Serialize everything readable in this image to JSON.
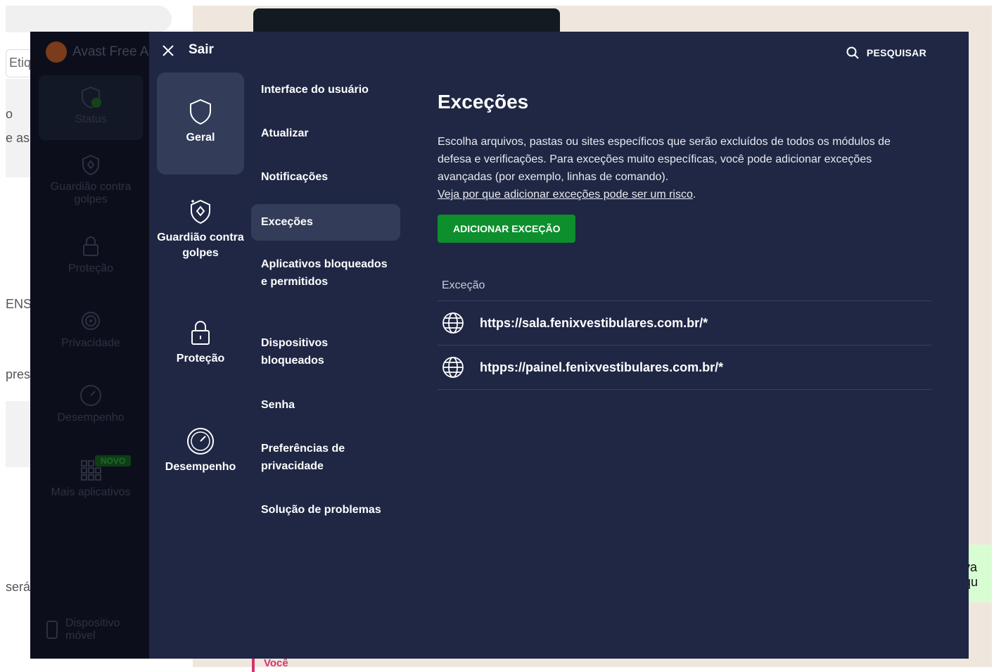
{
  "background": {
    "tag_text": "Etiq",
    "fragments": [
      "o",
      "e as",
      "ENS",
      "pres",
      "será"
    ],
    "right_fragment": "va qu",
    "chat_author": "Você"
  },
  "app": {
    "title": "Avast Free A",
    "sidebar": [
      {
        "label": "Status",
        "icon": "shield-check-icon"
      },
      {
        "label": "Guardião contra golpes",
        "icon": "scam-guardian-icon"
      },
      {
        "label": "Proteção",
        "icon": "lock-icon"
      },
      {
        "label": "Privacidade",
        "icon": "fingerprint-icon"
      },
      {
        "label": "Desempenho",
        "icon": "speedometer-icon"
      },
      {
        "label": "Mais aplicativos",
        "icon": "apps-grid-icon"
      },
      {
        "label": "Dispositivo móvel",
        "icon": "mobile-icon"
      }
    ],
    "badge": "NOVO"
  },
  "settings": {
    "close_label": "Sair",
    "search_label": "PESQUISAR",
    "categories": [
      {
        "label": "Geral",
        "icon": "shield-icon",
        "active": true
      },
      {
        "label": "Guardião contra golpes",
        "icon": "scam-guardian-icon"
      },
      {
        "label": "Proteção",
        "icon": "lock-icon"
      },
      {
        "label": "Desempenho",
        "icon": "speedometer-icon"
      }
    ],
    "subitems": [
      "Interface do usuário",
      "Atualizar",
      "Notificações",
      "Exceções",
      "Aplicativos bloqueados e permitidos",
      "Dispositivos bloqueados",
      "Senha",
      "Preferências de privacidade",
      "Solução de problemas"
    ],
    "active_subitem": "Exceções"
  },
  "content": {
    "title": "Exceções",
    "description": "Escolha arquivos, pastas ou sites específicos que serão excluídos de todos os módulos de defesa e verificações. Para exceções muito específicas, você pode adicionar exceções avançadas (por exemplo, linhas de comando).",
    "link": "Veja por que adicionar exceções pode ser um risco",
    "link_suffix": ".",
    "add_button": "ADICIONAR EXCEÇÃO",
    "list_header": "Exceção",
    "exceptions": [
      "https://sala.fenixvestibulares.com.br/*",
      "htpps://painel.fenixvestibulares.com.br/*"
    ]
  },
  "colors": {
    "overlay_bg": "#1f2744",
    "active_item_bg": "#333d59",
    "accent_green": "#0c8f2c"
  }
}
